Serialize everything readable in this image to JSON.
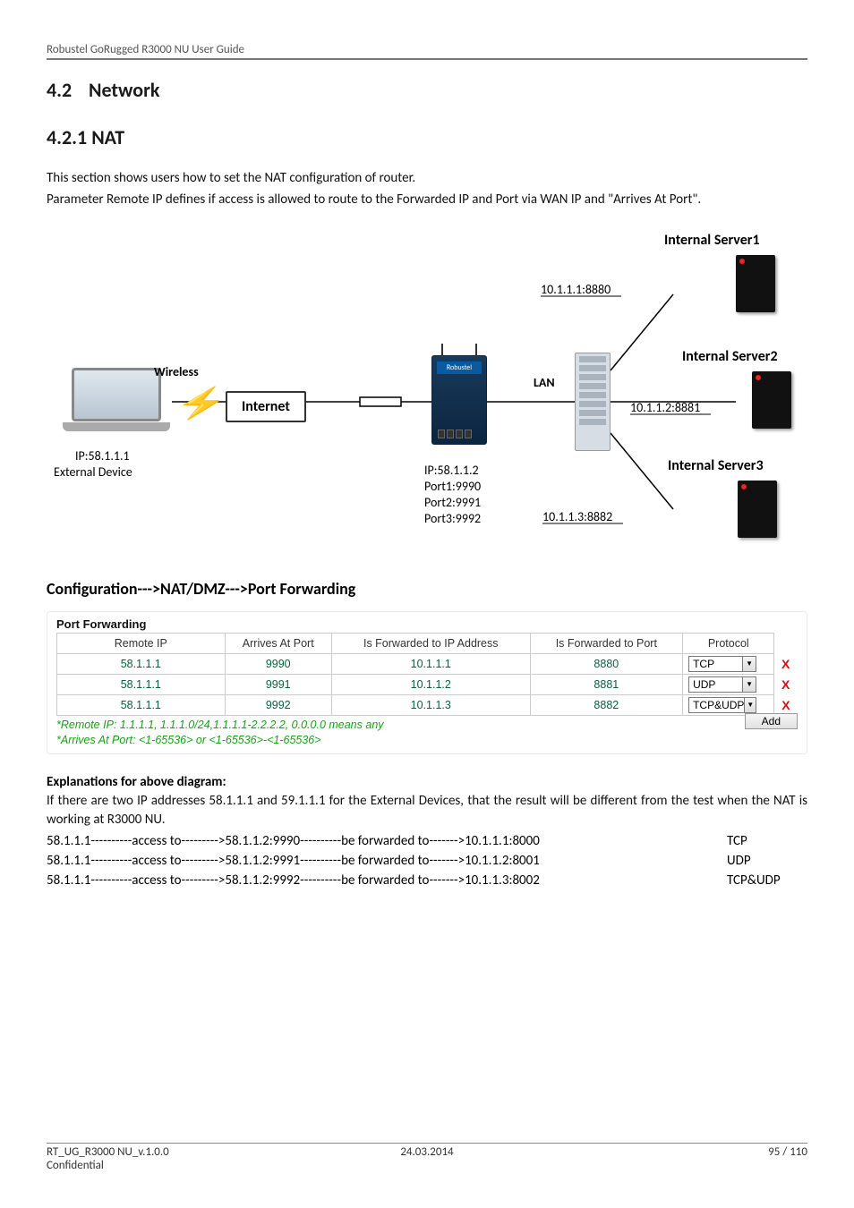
{
  "header": {
    "title": "Robustel GoRugged R3000 NU User Guide"
  },
  "section": {
    "num": "4.2",
    "title": "Network"
  },
  "subsection": {
    "num": "4.2.1",
    "title": "NAT"
  },
  "intro": {
    "p1": "This section shows users how to set the NAT configuration of router.",
    "p2": "Parameter Remote IP defines if access is allowed to route to the Forwarded IP and Port via WAN IP and \"Arrives At Port\"."
  },
  "diagram": {
    "server1": "Internal Server1",
    "server1_addr": "10.1.1.1:8880",
    "server2": "Internal Server2",
    "server2_addr": "10.1.1.2:8881",
    "server3": "Internal Server3",
    "server3_addr": "10.1.1.3:8882",
    "wireless": "Wireless",
    "internet": "Internet",
    "lan": "LAN",
    "laptop_ip": "IP:58.1.1.1",
    "laptop_label": "External Device",
    "router_ip": "IP:58.1.1.2",
    "router_p1": "Port1:9990",
    "router_p2": "Port2:9991",
    "router_p3": "Port3:9992"
  },
  "config_heading": "Configuration--->NAT/DMZ--->Port Forwarding",
  "pf": {
    "title": "Port Forwarding",
    "cols": {
      "remote_ip": "Remote IP",
      "arrives": "Arrives At Port",
      "fwd_ip": "Is Forwarded to IP Address",
      "fwd_port": "Is Forwarded to Port",
      "proto": "Protocol"
    },
    "rows": [
      {
        "remote_ip": "58.1.1.1",
        "arrives": "9990",
        "fwd_ip": "10.1.1.1",
        "fwd_port": "8880",
        "proto": "TCP"
      },
      {
        "remote_ip": "58.1.1.1",
        "arrives": "9991",
        "fwd_ip": "10.1.1.2",
        "fwd_port": "8881",
        "proto": "UDP"
      },
      {
        "remote_ip": "58.1.1.1",
        "arrives": "9992",
        "fwd_ip": "10.1.1.3",
        "fwd_port": "8882",
        "proto": "TCP&UDP"
      }
    ],
    "note1": "*Remote IP: 1.1.1.1, 1.1.1.0/24,1.1.1.1-2.2.2.2, 0.0.0.0 means any",
    "note2": "*Arrives At Port: <1-65536> or <1-65536>-<1-65536>",
    "add": "Add"
  },
  "expl": {
    "heading": "Explanations for above diagram:",
    "p": "If there are two IP addresses 58.1.1.1 and 59.1.1.1 for the External Devices, that the result will be different from the test when the NAT is working at R3000 NU.",
    "rows": [
      {
        "line": "58.1.1.1----------access to--------->58.1.1.2:9990----------be forwarded to------->10.1.1.1:8000",
        "proto": "TCP"
      },
      {
        "line": "58.1.1.1----------access to--------->58.1.1.2:9991----------be forwarded to------->10.1.1.2:8001",
        "proto": "UDP"
      },
      {
        "line": "58.1.1.1----------access to--------->58.1.1.2:9992----------be forwarded to------->10.1.1.3:8002",
        "proto": "TCP&UDP"
      }
    ]
  },
  "footer": {
    "left": "RT_UG_R3000 NU_v.1.0.0",
    "center": "24.03.2014",
    "right": "95 / 110",
    "conf": "Confidential"
  }
}
